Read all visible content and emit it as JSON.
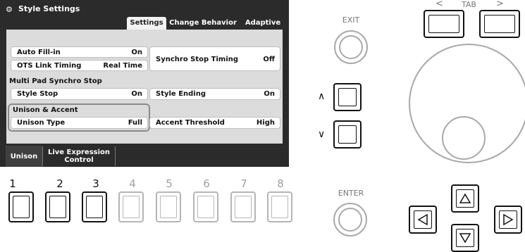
{
  "header": {
    "title": "Style Settings",
    "tabs": [
      "Settings",
      "Change Behavior",
      "Adaptive"
    ],
    "active_tab": "Settings"
  },
  "settings": {
    "auto_fill_in": {
      "label": "Auto Fill-in",
      "value": "On"
    },
    "ots_link_timing": {
      "label": "OTS Link Timing",
      "value": "Real Time"
    },
    "synchro_stop_timing": {
      "label": "Synchro Stop Timing",
      "value": "Off"
    },
    "multi_pad_section": "Multi Pad Synchro Stop",
    "style_stop": {
      "label": "Style Stop",
      "value": "On"
    },
    "style_ending": {
      "label": "Style Ending",
      "value": "On"
    },
    "unison_accent_section": "Unison & Accent",
    "unison_type": {
      "label": "Unison Type",
      "value": "Full"
    },
    "accent_threshold": {
      "label": "Accent Threshold",
      "value": "High"
    }
  },
  "bottom_tabs": {
    "unison": "Unison",
    "live_expression_line1": "Live Expression",
    "live_expression_line2": "Control"
  },
  "panel": {
    "numbers": [
      "1",
      "2",
      "3",
      "4",
      "5",
      "6",
      "7",
      "8"
    ],
    "exit_label": "EXIT",
    "enter_label": "ENTER",
    "tab_label": "TAB",
    "tab_left": "<",
    "tab_right": ">",
    "up_symbol": "∧",
    "down_symbol": "∨"
  },
  "icons": {
    "title_icon": "style-settings-icon",
    "pad_up": "triangle-up-icon",
    "pad_down": "triangle-down-icon",
    "pad_left": "triangle-left-icon",
    "pad_right": "triangle-right-icon"
  },
  "colors": {
    "screen_bg": "#2b2b2b",
    "content_bg": "#dcdcdc",
    "highlight_border": "#8a8a8a"
  }
}
